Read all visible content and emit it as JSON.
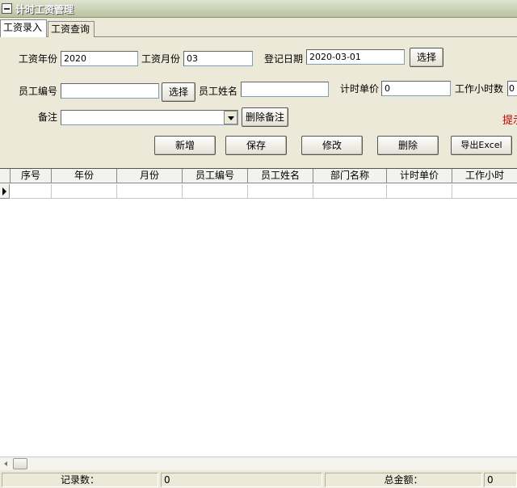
{
  "window": {
    "title": "计时工资管理"
  },
  "tabs": [
    {
      "label": "工资录入"
    },
    {
      "label": "工资查询"
    }
  ],
  "form": {
    "year_label": "工资年份",
    "year_value": "2020",
    "month_label": "工资月份",
    "month_value": "03",
    "date_label": "登记日期",
    "date_value": "2020-03-01",
    "date_pick_label": "选择",
    "emp_no_label": "员工编号",
    "emp_no_value": "",
    "emp_pick_label": "选择",
    "emp_name_label": "员工姓名",
    "emp_name_value": "",
    "unit_price_label": "计时单价",
    "unit_price_value": "0",
    "hours_label": "工作小时数",
    "hours_value": "0",
    "remark_label": "备注",
    "remark_value": "",
    "delete_remark_label": "删除备注",
    "hint_text": "提示"
  },
  "actions": {
    "add": "新增",
    "save": "保存",
    "edit": "修改",
    "delete": "删除",
    "export": "导出Excel"
  },
  "grid": {
    "columns": [
      "序号",
      "年份",
      "月份",
      "员工编号",
      "员工姓名",
      "部门名称",
      "计时单价",
      "工作小时"
    ]
  },
  "status": {
    "record_count_label": "记录数：",
    "record_count_value": "0",
    "total_label": "总金额：",
    "total_value": "0"
  },
  "colors": {
    "hint": "#c00000",
    "title_bar": "#b9c1a0"
  }
}
